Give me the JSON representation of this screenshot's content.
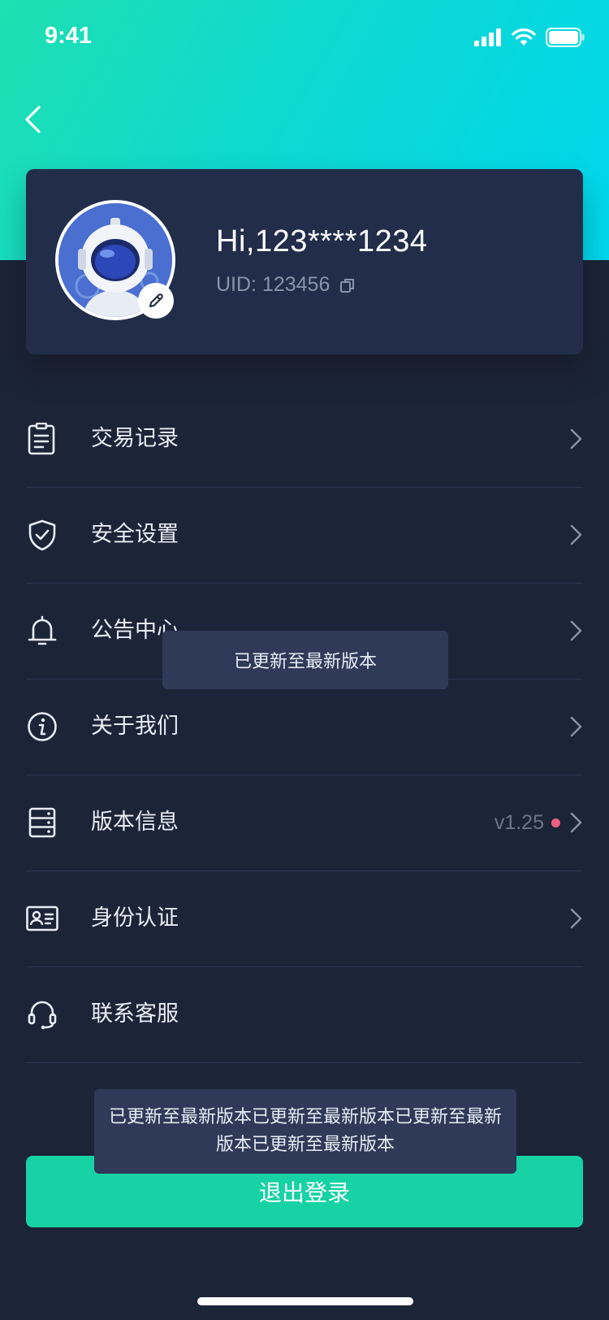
{
  "status_bar": {
    "time": "9:41"
  },
  "profile": {
    "greeting": "Hi,123****1234",
    "uid": "UID: 123456"
  },
  "menu": [
    {
      "label": "交易记录",
      "icon": "document-list-icon"
    },
    {
      "label": "安全设置",
      "icon": "shield-check-icon"
    },
    {
      "label": "公告中心",
      "icon": "bell-icon"
    },
    {
      "label": "关于我们",
      "icon": "info-icon"
    },
    {
      "label": "版本信息",
      "icon": "server-icon",
      "value": "v1.25",
      "badge_color": "#f0607e"
    },
    {
      "label": "身份认证",
      "icon": "id-card-icon"
    },
    {
      "label": "联系客服",
      "icon": "headset-icon"
    }
  ],
  "toasts": {
    "short": "已更新至最新版本",
    "long": "已更新至最新版本已更新至最新版本已更新至最新版本已更新至最新版本"
  },
  "logout_label": "退出登录",
  "colors": {
    "header_gradient_start": "#1ee0b0",
    "header_gradient_end": "#00d7ee",
    "background": "#1c2438",
    "card": "#222d4a",
    "accent": "#16d2a4",
    "badge": "#f0607e"
  }
}
